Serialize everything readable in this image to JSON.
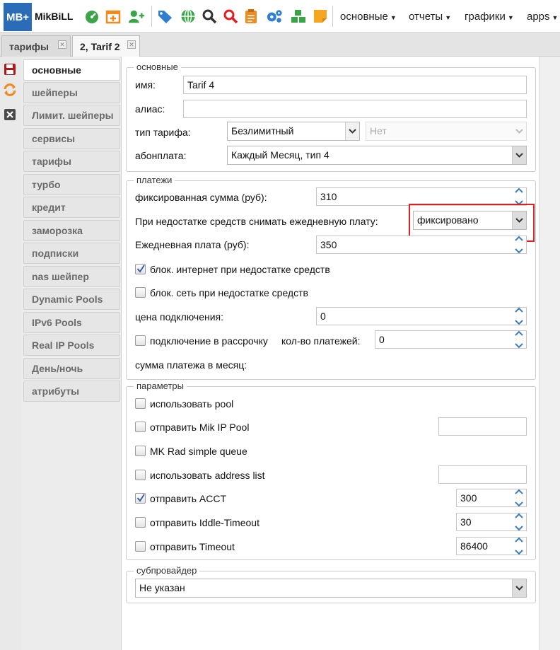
{
  "header": {
    "logo_badge": "MB+",
    "logo_text": "MikBiLL",
    "icons": [
      "dashboard-icon",
      "calendar-add-icon",
      "add-user-icon",
      "tags-icon",
      "globe-icon",
      "search-icon",
      "search-red-icon",
      "clipboard-icon",
      "gears-icon",
      "cubes-icon",
      "sticky-note-icon"
    ],
    "menus": [
      "основные",
      "отчеты",
      "графики",
      "apps"
    ]
  },
  "tabs": [
    {
      "label": "тарифы"
    },
    {
      "label": "2, Tarif 2"
    }
  ],
  "sidenav": {
    "items": [
      "основные",
      "шейперы",
      "Лимит. шейперы",
      "сервисы",
      "тарифы",
      "турбо",
      "кредит",
      "заморозка",
      "подписки",
      "nas шейпер",
      "Dynamic Pools",
      "IPv6 Pools",
      "Real IP Pools",
      "День/ночь",
      "атрибуты"
    ],
    "active": "основные"
  },
  "basic": {
    "legend": "основные",
    "name_label": "имя:",
    "name_value": "Tarif 4",
    "alias_label": "алиас:",
    "alias_value": "",
    "type_label": "тип тарифа:",
    "type_value": "Безлимитный",
    "type_extra_value": "Нет",
    "fee_label": "абонплата:",
    "fee_value": "Каждый Месяц, тип 4"
  },
  "payments": {
    "legend": "платежи",
    "fixed_label": "фиксированная сумма (руб):",
    "fixed_value": "310",
    "insufficient_label": "При недостатке средств снимать ежедневную плату:",
    "insufficient_value": "фиксировано",
    "daily_label": "Ежедневная плата (руб):",
    "daily_value": "350",
    "block_internet_label": "блок. интернет при недостатке средств",
    "block_internet_checked": true,
    "block_net_label": "блок. сеть при недостатке средств",
    "block_net_checked": false,
    "connection_price_label": "цена подключения:",
    "connection_price_value": "0",
    "installment_label": "подключение в рассрочку",
    "installment_checked": false,
    "payments_count_label": "кол-во платежей:",
    "payments_count_value": "0",
    "monthly_sum_label": "сумма платежа в месяц:"
  },
  "params": {
    "legend": "параметры",
    "use_pool_label": "использовать pool",
    "mik_ip_pool_label": "отправить Mik IP Pool",
    "mik_ip_pool_value": "",
    "mk_rad_label": "MK Rad simple queue",
    "address_list_label": "использовать address list",
    "address_list_value": "",
    "acct_label": "отправить ACCT",
    "acct_checked": true,
    "acct_value": "300",
    "idle_label": "отправить Iddle-Timeout",
    "idle_value": "30",
    "timeout_label": "отправить Timeout",
    "timeout_value": "86400"
  },
  "subprovider": {
    "legend": "субпровайдер",
    "value": "Не указан"
  },
  "colors": {
    "accent": "#2b6cb8",
    "highlight": "#e02020",
    "spinner": "#3a7bbf"
  }
}
